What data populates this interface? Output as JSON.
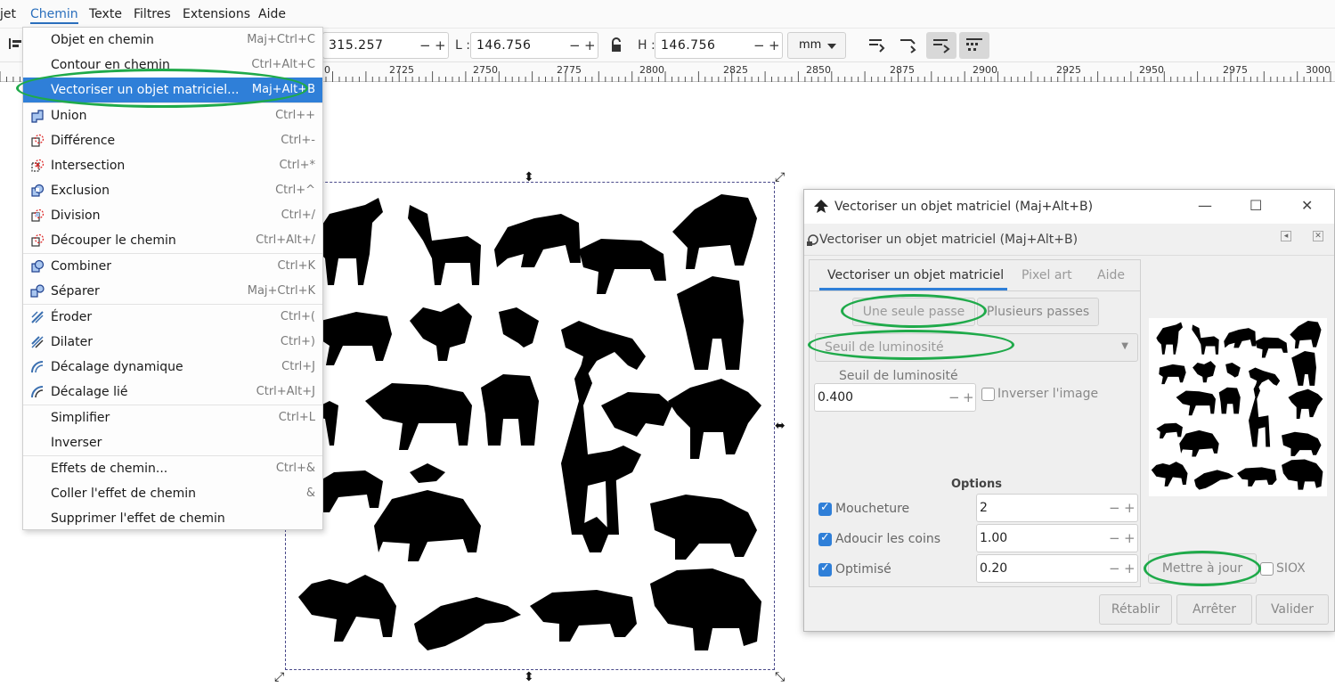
{
  "menubar": {
    "items": [
      "jet",
      "Chemin",
      "Texte",
      "Filtres",
      "Extensions",
      "Aide"
    ]
  },
  "toolbar": {
    "x_value": "315.257",
    "w_label": "L :",
    "w_value": "146.756",
    "h_label": "H :",
    "h_value": "146.756",
    "unit": "mm",
    "plus": "+",
    "minus": "−"
  },
  "ruler": {
    "labels": [
      "0",
      "2725",
      "2750",
      "2775",
      "2800",
      "2825",
      "2850",
      "2875",
      "2900",
      "2925",
      "2950",
      "2975",
      "3000"
    ]
  },
  "menu": {
    "items": [
      {
        "label": "Objet en chemin",
        "shortcut": "Maj+Ctrl+C",
        "icon": ""
      },
      {
        "label": "Contour en chemin",
        "shortcut": "Ctrl+Alt+C",
        "icon": ""
      },
      {
        "label": "Vectoriser un objet matriciel...",
        "shortcut": "Maj+Alt+B",
        "icon": ""
      },
      {
        "label": "Union",
        "shortcut": "Ctrl++",
        "icon": "union-icon"
      },
      {
        "label": "Différence",
        "shortcut": "Ctrl+-",
        "icon": "difference-icon"
      },
      {
        "label": "Intersection",
        "shortcut": "Ctrl+*",
        "icon": "intersection-icon"
      },
      {
        "label": "Exclusion",
        "shortcut": "Ctrl+^",
        "icon": "exclusion-icon"
      },
      {
        "label": "Division",
        "shortcut": "Ctrl+/",
        "icon": "division-icon"
      },
      {
        "label": "Découper le chemin",
        "shortcut": "Ctrl+Alt+/",
        "icon": "cut-path-icon"
      },
      {
        "label": "Combiner",
        "shortcut": "Ctrl+K",
        "icon": "combine-icon"
      },
      {
        "label": "Séparer",
        "shortcut": "Maj+Ctrl+K",
        "icon": "separate-icon"
      },
      {
        "label": "Éroder",
        "shortcut": "Ctrl+(",
        "icon": "erode-icon"
      },
      {
        "label": "Dilater",
        "shortcut": "Ctrl+)",
        "icon": "dilate-icon"
      },
      {
        "label": "Décalage dynamique",
        "shortcut": "Ctrl+J",
        "icon": "dynamic-offset-icon"
      },
      {
        "label": "Décalage lié",
        "shortcut": "Ctrl+Alt+J",
        "icon": "linked-offset-icon"
      },
      {
        "label": "Simplifier",
        "shortcut": "Ctrl+L",
        "icon": ""
      },
      {
        "label": "Inverser",
        "shortcut": "",
        "icon": ""
      },
      {
        "label": "Effets de chemin...",
        "shortcut": "Ctrl+&",
        "icon": ""
      },
      {
        "label": "Coller l'effet de chemin",
        "shortcut": "&",
        "icon": ""
      },
      {
        "label": "Supprimer l'effet de chemin",
        "shortcut": "",
        "icon": ""
      }
    ]
  },
  "dialog": {
    "title": "Vectoriser un objet matriciel (Maj+Alt+B)",
    "subtitle": "Vectoriser un objet matriciel (Maj+Alt+B)",
    "tabs": [
      "Vectoriser un objet matriciel",
      "Pixel art",
      "Aide"
    ],
    "single_pass": "Une seule passe",
    "multi_pass": "Plusieurs passes",
    "mode": "Seuil de luminosité",
    "threshold_label": "Seuil de luminosité",
    "threshold_value": "0.400",
    "invert_label": "Inverser l'image",
    "options_title": "Options",
    "options": [
      {
        "label": "Moucheture",
        "value": "2",
        "checked": true
      },
      {
        "label": "Adoucir les coins",
        "value": "1.00",
        "checked": true
      },
      {
        "label": "Optimisé",
        "value": "0.20",
        "checked": true
      }
    ],
    "update_button": "Mettre à jour",
    "siox_label": "SIOX",
    "reset_button": "Rétablir",
    "stop_button": "Arrêter",
    "ok_button": "Valider",
    "plus": "+",
    "minus": "−"
  }
}
